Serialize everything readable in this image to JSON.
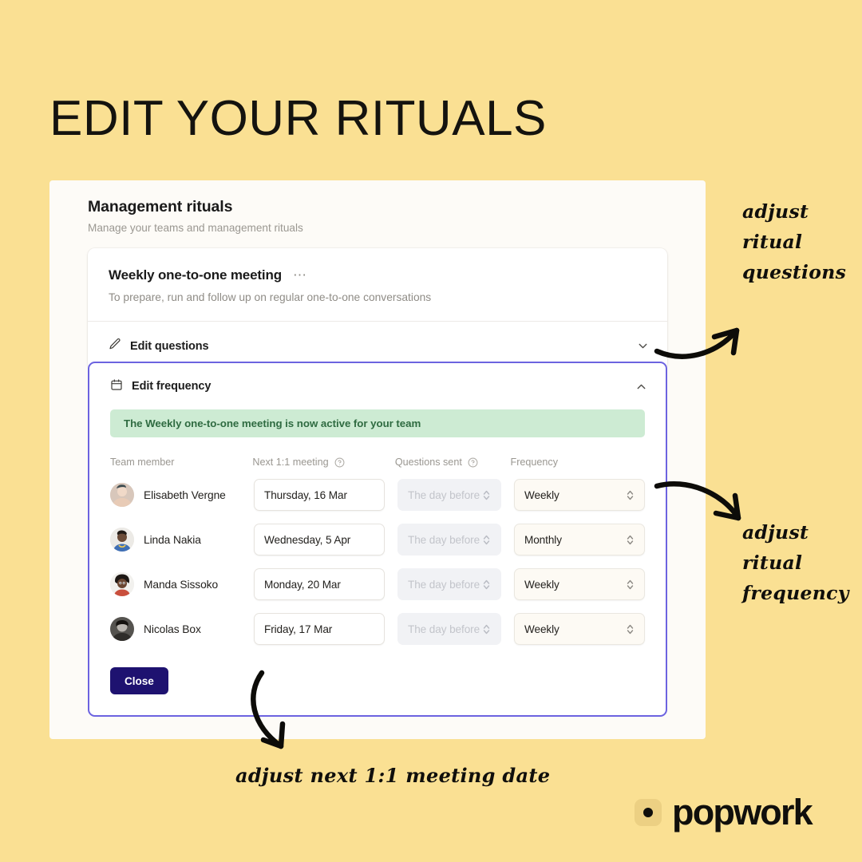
{
  "page": {
    "title": "EDIT YOUR RITUALS",
    "background_color": "#fae093"
  },
  "panel": {
    "title": "Management rituals",
    "subtitle": "Manage your teams and management rituals"
  },
  "ritual": {
    "name": "Weekly one-to-one meeting",
    "description": "To prepare, run and follow up on regular one-to-one conversations",
    "menu_icon": "ellipsis-icon"
  },
  "accordion": {
    "questions": {
      "label": "Edit questions",
      "icon": "pencil-icon",
      "caret": "chevron-down-icon",
      "expanded": false
    },
    "frequency": {
      "label": "Edit frequency",
      "icon": "calendar-icon",
      "caret": "chevron-up-icon",
      "expanded": true,
      "border_color": "#6c63e0"
    }
  },
  "banner": {
    "text": "The Weekly one-to-one meeting is now active for your team",
    "background_color": "#cdebd3",
    "text_color": "#2f6b41"
  },
  "table": {
    "headers": {
      "member": "Team member",
      "next": "Next 1:1 meeting",
      "questions": "Questions sent",
      "frequency": "Frequency"
    },
    "help_icon": "question-circle-icon",
    "rows": [
      {
        "name": "Elisabeth Vergne",
        "next_meeting": "Thursday, 16 Mar",
        "questions_sent": "The day before",
        "frequency": "Weekly",
        "avatar": "avatar-photo"
      },
      {
        "name": "Linda Nakia",
        "next_meeting": "Wednesday, 5 Apr",
        "questions_sent": "The day before",
        "frequency": "Monthly",
        "avatar": "avatar-photo"
      },
      {
        "name": "Manda Sissoko",
        "next_meeting": "Monday, 20 Mar",
        "questions_sent": "The day before",
        "frequency": "Weekly",
        "avatar": "avatar-photo"
      },
      {
        "name": "Nicolas Box",
        "next_meeting": "Friday, 17 Mar",
        "questions_sent": "The day before",
        "frequency": "Weekly",
        "avatar": "avatar-photo"
      }
    ],
    "close_label": "Close",
    "close_color": "#1e1270"
  },
  "annotations": {
    "questions": "adjust\nritual\nquestions",
    "frequency": "adjust\nritual\nfrequency",
    "date": "adjust next 1:1 meeting date"
  },
  "logo": {
    "text": "popwork",
    "mark": "dot-square-icon"
  }
}
